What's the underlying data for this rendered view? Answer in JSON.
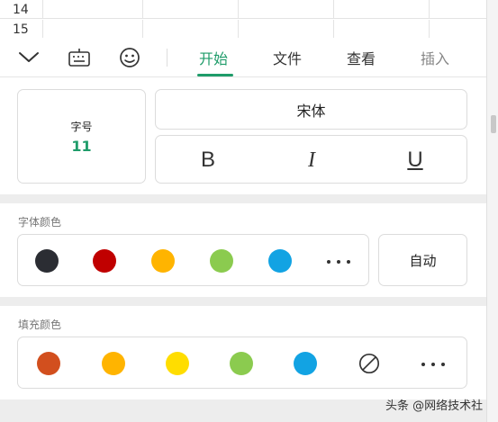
{
  "sheet": {
    "rows": [
      "14",
      "15"
    ]
  },
  "toolbar": {
    "icons": [
      "chevron-down-icon",
      "keyboard-icon",
      "emoji-icon"
    ],
    "tabs": [
      {
        "label": "开始",
        "active": true
      },
      {
        "label": "文件",
        "active": false
      },
      {
        "label": "查看",
        "active": false
      },
      {
        "label": "插入",
        "active": false
      }
    ],
    "accent_color": "#1f9c6a"
  },
  "font": {
    "size_label": "字号",
    "size_value": "11",
    "font_name": "宋体",
    "bold_label": "B",
    "italic_label": "I",
    "underline_label": "U"
  },
  "font_color": {
    "title": "字体颜色",
    "swatches": [
      "#2b2d33",
      "#c00000",
      "#ffb400",
      "#8bcb4f",
      "#12a3e3"
    ],
    "auto_label": "自动"
  },
  "fill_color": {
    "title": "填充颜色",
    "swatches": [
      "#d24f1e",
      "#ffb400",
      "#ffdd00",
      "#8bcb4f",
      "#12a3e3"
    ]
  },
  "watermark": "头条 @网络技术社"
}
